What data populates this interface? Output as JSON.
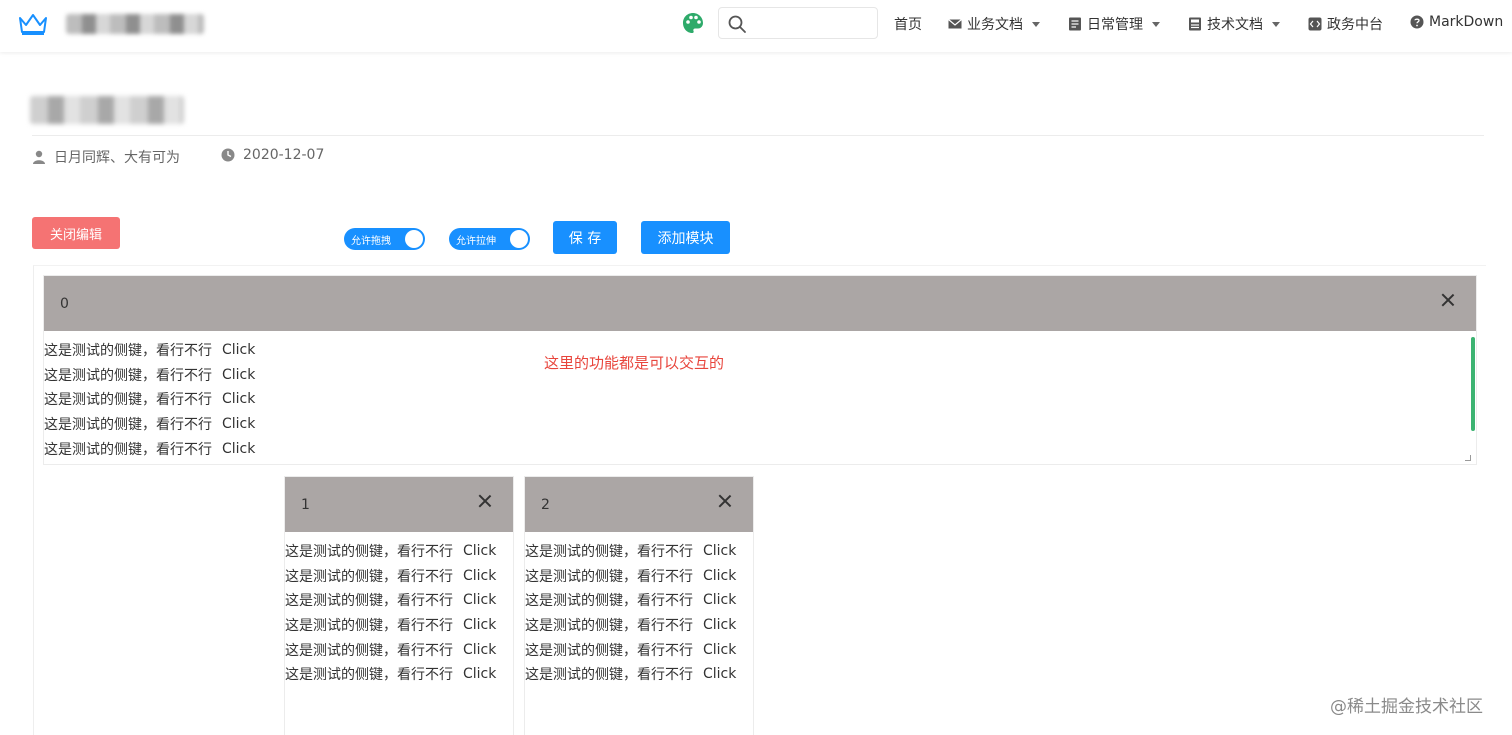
{
  "nav": {
    "search_placeholder": "",
    "items": [
      {
        "label": "首页",
        "icon": ""
      },
      {
        "label": "业务文档",
        "icon": "mail-icon"
      },
      {
        "label": "日常管理",
        "icon": "doc-icon"
      },
      {
        "label": "技术文档",
        "icon": "book-icon"
      },
      {
        "label": "政务中台",
        "icon": "code-icon"
      },
      {
        "label": "MarkDown",
        "icon": "help-icon"
      }
    ]
  },
  "meta": {
    "author": "日月同辉、大有可为",
    "date": "2020-12-07"
  },
  "toolbar": {
    "close_edit": "关闭编辑",
    "toggle_drag": "允许拖拽",
    "toggle_resize": "允许拉伸",
    "save": "保 存",
    "add_module": "添加模块"
  },
  "modules": [
    {
      "id": "0",
      "line_text": "这是测试的侧键，看行不行",
      "click_label": "Click",
      "line_count": 5
    },
    {
      "id": "1",
      "line_text": "这是测试的侧键，看行不行",
      "click_label": "Click",
      "line_count": 6
    },
    {
      "id": "2",
      "line_text": "这是测试的侧键，看行不行",
      "click_label": "Click",
      "line_count": 6
    }
  ],
  "note": "这里的功能都是可以交互的",
  "watermark": "@稀土掘金技术社区",
  "colors": {
    "primary": "#1890ff",
    "danger": "#f56c6c",
    "module_header": "#aba6a5",
    "note": "#e8453c",
    "scrollbar": "#3cb371"
  }
}
